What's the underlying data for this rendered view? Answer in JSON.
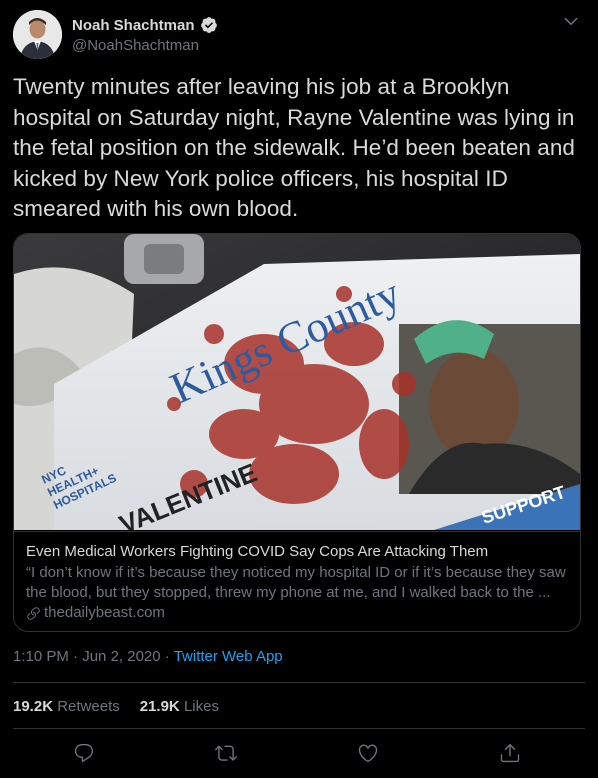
{
  "author": {
    "display_name": "Noah Shachtman",
    "handle": "@NoahShachtman",
    "verified": true
  },
  "tweet": {
    "text": "Twenty minutes after leaving his job at a Brooklyn hospital on Saturday night, Rayne Valentine was lying in the fetal position on the sidewalk. He’d been beaten and kicked by New York police officers, his hospital ID smeared with his own blood."
  },
  "card": {
    "image_text": {
      "kings_county": "Kings County",
      "nyc": "NYC",
      "health_hospitals_line1": "HEALTH+",
      "health_hospitals_line2": "HOSPITALS",
      "name": "VALENTINE",
      "department": "SUPPORT"
    },
    "title": "Even Medical Workers Fighting COVID Say Cops Are Attacking Them",
    "description": "“I don’t know if it’s because they noticed my hospital ID or if it’s because they saw the blood, but they stopped, threw my phone at me, and I walked back to the ...",
    "domain": "thedailybeast.com"
  },
  "meta": {
    "time": "1:10 PM",
    "separator": "·",
    "date": "Jun 2, 2020",
    "source": "Twitter Web App"
  },
  "stats": {
    "retweets_count": "19.2K",
    "retweets_label": "Retweets",
    "likes_count": "21.9K",
    "likes_label": "Likes"
  },
  "actions": [
    "reply-icon",
    "retweet-icon",
    "like-icon",
    "share-icon"
  ],
  "colors": {
    "background": "#000000",
    "text": "#d9d9d9",
    "secondary": "#6e767d",
    "accent": "#1da1f2",
    "border": "#2f3336"
  }
}
